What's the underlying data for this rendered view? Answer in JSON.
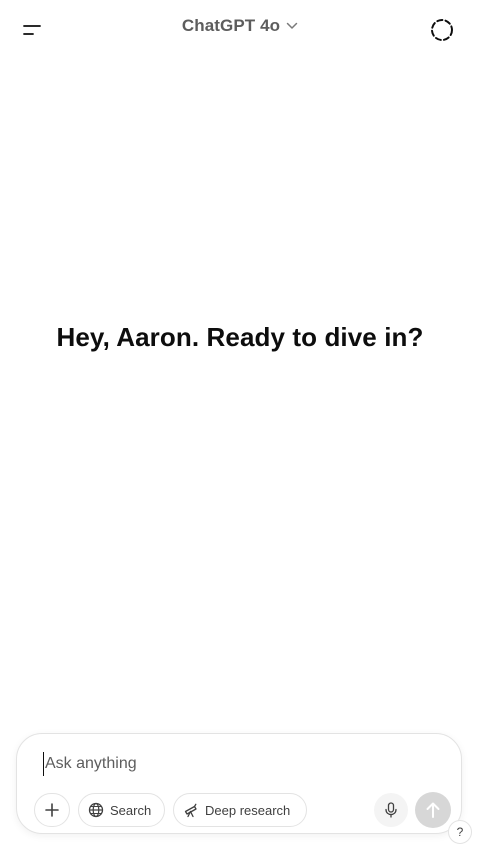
{
  "header": {
    "menu_icon": "sidebar-toggle-icon",
    "model_name": "ChatGPT 4o",
    "model_chevron_icon": "chevron-down-icon",
    "temporary_chat_icon": "dashed-circle-icon"
  },
  "main": {
    "greeting": "Hey, Aaron. Ready to dive in?"
  },
  "composer": {
    "placeholder": "Ask anything",
    "value": "",
    "attach_icon": "plus-icon",
    "search_label": "Search",
    "search_icon": "globe-icon",
    "deep_research_label": "Deep research",
    "deep_research_icon": "telescope-icon",
    "mic_icon": "microphone-icon",
    "send_icon": "arrow-up-icon"
  },
  "help": {
    "label": "?"
  },
  "colors": {
    "text_primary": "#0d0d0d",
    "text_secondary": "#5d5d5d",
    "border": "#e3e3e3",
    "send_disabled": "#d7d7d7",
    "mic_bg": "#f4f4f4"
  }
}
